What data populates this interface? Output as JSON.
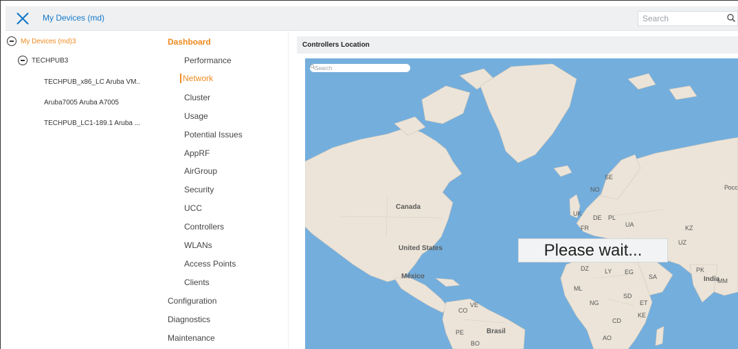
{
  "header": {
    "title": "My Devices (md)",
    "search_placeholder": "Search"
  },
  "tree": {
    "root_label": "My Devices (md)3",
    "group_label": "TECHPUB3",
    "devices": [
      "TECHPUB_x86_LC Aruba VM..",
      "Aruba7005 Aruba A7005",
      "TECHPUB_LC1-189.1 Aruba ..."
    ]
  },
  "menu": {
    "heading": "Dashboard",
    "dashboard_items": [
      "Performance",
      "Network",
      "Cluster",
      "Usage",
      "Potential Issues",
      "AppRF",
      "AirGroup",
      "Security",
      "UCC",
      "Controllers",
      "WLANs",
      "Access Points",
      "Clients"
    ],
    "active_item": "Network",
    "sections": [
      "Configuration",
      "Diagnostics",
      "Maintenance"
    ]
  },
  "panel": {
    "title": "Controllers Location",
    "map_search_placeholder": "Search",
    "loading_text": "Please wait...",
    "map_labels": [
      "Canada",
      "United States",
      "México",
      "Brasil",
      "India",
      "NO",
      "SE",
      "UK",
      "DE",
      "PL",
      "FR",
      "UA",
      "KZ",
      "UZ",
      "PK",
      "DZ",
      "LY",
      "EG",
      "SA",
      "ML",
      "NG",
      "SD",
      "ET",
      "CD",
      "KE",
      "AO",
      "CO",
      "VE",
      "PE",
      "BO",
      "MM",
      "Росс"
    ]
  },
  "colors": {
    "accent": "#f0891e",
    "link_blue": "#1478c8",
    "ocean": "#74aedd",
    "land": "#ece4d8"
  }
}
